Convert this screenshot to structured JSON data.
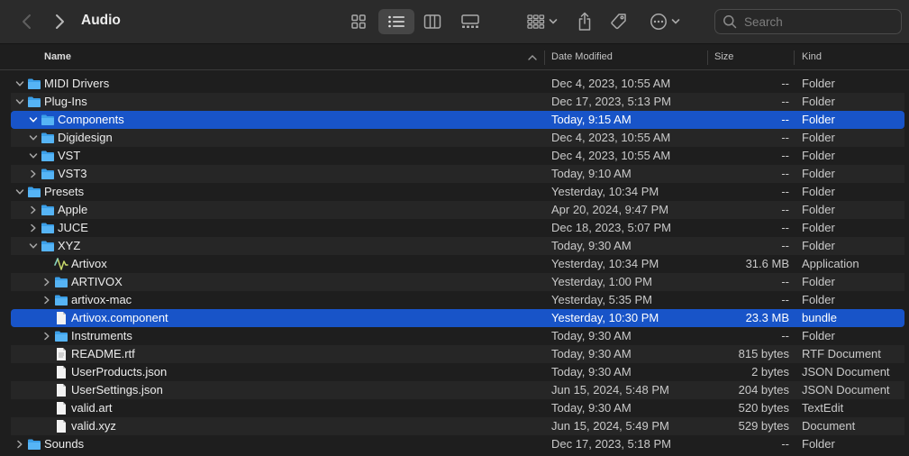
{
  "window": {
    "title": "Audio"
  },
  "search": {
    "placeholder": "Search",
    "value": ""
  },
  "columns": {
    "name": "Name",
    "date": "Date Modified",
    "size": "Size",
    "kind": "Kind"
  },
  "colors": {
    "selection": "#1854c8",
    "folder": "#3b9fe8",
    "background": "#1e1e1e"
  },
  "rows": [
    {
      "name": "MIDI Drivers",
      "date": "Dec 4, 2023, 10:55 AM",
      "size": "--",
      "kind": "Folder",
      "level": 0,
      "disclosure": "down",
      "icon": "folder-icon",
      "selected": false
    },
    {
      "name": "Plug-Ins",
      "date": "Dec 17, 2023, 5:13 PM",
      "size": "--",
      "kind": "Folder",
      "level": 0,
      "disclosure": "down",
      "icon": "folder-icon",
      "selected": false
    },
    {
      "name": "Components",
      "date": "Today, 9:15 AM",
      "size": "--",
      "kind": "Folder",
      "level": 1,
      "disclosure": "down",
      "icon": "folder-icon",
      "selected": true
    },
    {
      "name": "Digidesign",
      "date": "Dec 4, 2023, 10:55 AM",
      "size": "--",
      "kind": "Folder",
      "level": 1,
      "disclosure": "down",
      "icon": "folder-icon",
      "selected": false
    },
    {
      "name": "VST",
      "date": "Dec 4, 2023, 10:55 AM",
      "size": "--",
      "kind": "Folder",
      "level": 1,
      "disclosure": "down",
      "icon": "folder-icon",
      "selected": false
    },
    {
      "name": "VST3",
      "date": "Today, 9:10 AM",
      "size": "--",
      "kind": "Folder",
      "level": 1,
      "disclosure": "right",
      "icon": "folder-icon",
      "selected": false
    },
    {
      "name": "Presets",
      "date": "Yesterday, 10:34 PM",
      "size": "--",
      "kind": "Folder",
      "level": 0,
      "disclosure": "down",
      "icon": "folder-icon",
      "selected": false
    },
    {
      "name": "Apple",
      "date": "Apr 20, 2024, 9:47 PM",
      "size": "--",
      "kind": "Folder",
      "level": 1,
      "disclosure": "right",
      "icon": "folder-icon",
      "selected": false
    },
    {
      "name": "JUCE",
      "date": "Dec 18, 2023, 5:07 PM",
      "size": "--",
      "kind": "Folder",
      "level": 1,
      "disclosure": "right",
      "icon": "folder-icon",
      "selected": false
    },
    {
      "name": "XYZ",
      "date": "Today, 9:30 AM",
      "size": "--",
      "kind": "Folder",
      "level": 1,
      "disclosure": "down",
      "icon": "folder-icon",
      "selected": false
    },
    {
      "name": "Artivox",
      "date": "Yesterday, 10:34 PM",
      "size": "31.6 MB",
      "kind": "Application",
      "level": 2,
      "disclosure": "none",
      "icon": "waveform-app-icon",
      "selected": false
    },
    {
      "name": "ARTIVOX",
      "date": "Yesterday, 1:00 PM",
      "size": "--",
      "kind": "Folder",
      "level": 2,
      "disclosure": "right",
      "icon": "folder-icon",
      "selected": false
    },
    {
      "name": "artivox-mac",
      "date": "Yesterday, 5:35 PM",
      "size": "--",
      "kind": "Folder",
      "level": 2,
      "disclosure": "right",
      "icon": "folder-icon",
      "selected": false
    },
    {
      "name": "Artivox.component",
      "date": "Yesterday, 10:30 PM",
      "size": "23.3 MB",
      "kind": "bundle",
      "level": 2,
      "disclosure": "none",
      "icon": "document-icon",
      "selected": true
    },
    {
      "name": "Instruments",
      "date": "Today, 9:30 AM",
      "size": "--",
      "kind": "Folder",
      "level": 2,
      "disclosure": "right",
      "icon": "folder-icon",
      "selected": false
    },
    {
      "name": "README.rtf",
      "date": "Today, 9:30 AM",
      "size": "815 bytes",
      "kind": "RTF Document",
      "level": 2,
      "disclosure": "none",
      "icon": "text-document-icon",
      "selected": false
    },
    {
      "name": "UserProducts.json",
      "date": "Today, 9:30 AM",
      "size": "2 bytes",
      "kind": "JSON Document",
      "level": 2,
      "disclosure": "none",
      "icon": "document-icon",
      "selected": false
    },
    {
      "name": "UserSettings.json",
      "date": "Jun 15, 2024, 5:48 PM",
      "size": "204 bytes",
      "kind": "JSON Document",
      "level": 2,
      "disclosure": "none",
      "icon": "document-icon",
      "selected": false
    },
    {
      "name": "valid.art",
      "date": "Today, 9:30 AM",
      "size": "520 bytes",
      "kind": "TextEdit",
      "level": 2,
      "disclosure": "none",
      "icon": "document-icon",
      "selected": false
    },
    {
      "name": "valid.xyz",
      "date": "Jun 15, 2024, 5:49 PM",
      "size": "529 bytes",
      "kind": "Document",
      "level": 2,
      "disclosure": "none",
      "icon": "document-icon",
      "selected": false
    },
    {
      "name": "Sounds",
      "date": "Dec 17, 2023, 5:18 PM",
      "size": "--",
      "kind": "Folder",
      "level": 0,
      "disclosure": "right",
      "icon": "folder-icon",
      "selected": false
    }
  ]
}
